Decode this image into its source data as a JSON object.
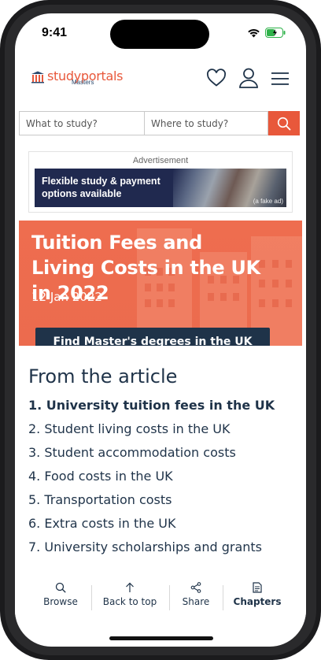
{
  "status": {
    "time": "9:41"
  },
  "header": {
    "logo_text": "studyportals",
    "logo_sub": "Masters",
    "icons": [
      "heart-icon",
      "user-icon",
      "menu-icon"
    ]
  },
  "search": {
    "what_placeholder": "What to study?",
    "where_placeholder": "Where to study?",
    "button_icon": "search-icon"
  },
  "ad": {
    "label": "Advertisement",
    "banner_text": "Flexible study & payment options available",
    "fake_label": "(a fake ad)"
  },
  "hero": {
    "title": "Tuition Fees and Living Costs in the UK in 2022",
    "date": "12 Jan 2022",
    "cta": "Find Master's degrees in the UK"
  },
  "article": {
    "heading": "From the article",
    "items": [
      "1. University tuition fees in the UK",
      "2. Student living costs in the UK",
      "3. Student accommodation costs",
      "4. Food costs in the UK",
      "5. Transportation costs",
      "6. Extra costs in the UK",
      "7. University scholarships and grants"
    ]
  },
  "bottom_nav": {
    "browse": "Browse",
    "back_to_top": "Back to top",
    "share": "Share",
    "chapters": "Chapters"
  },
  "colors": {
    "brand": "#e8583b",
    "navy": "#1f3349",
    "hero": "#ec6b4e"
  }
}
